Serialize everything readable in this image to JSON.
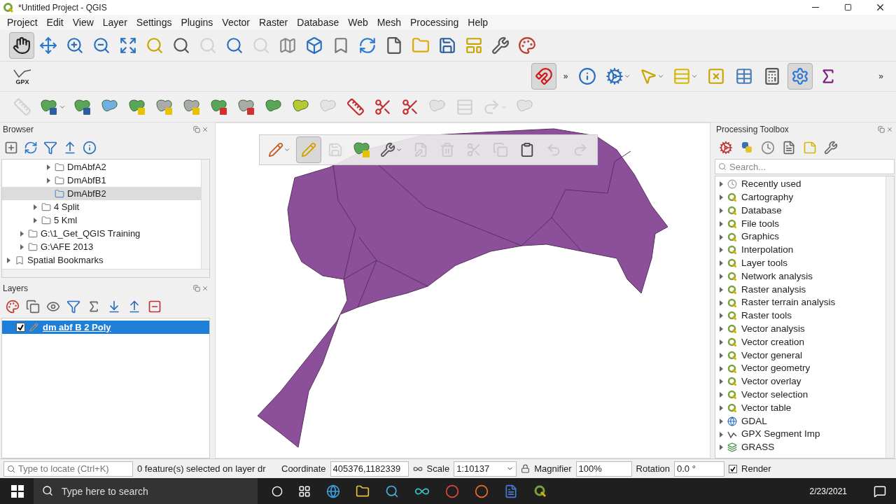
{
  "window": {
    "title": "*Untitled Project - QGIS"
  },
  "menu": [
    "Project",
    "Edit",
    "View",
    "Layer",
    "Settings",
    "Plugins",
    "Vector",
    "Raster",
    "Database",
    "Web",
    "Mesh",
    "Processing",
    "Help"
  ],
  "toolbar_1": [
    {
      "disabled": false,
      "selected": true
    },
    {
      "disabled": false,
      "selected": false
    },
    {
      "disabled": false,
      "selected": false
    },
    {
      "disabled": false,
      "selected": false
    },
    {
      "disabled": false,
      "selected": false
    },
    {
      "disabled": false,
      "selected": false
    },
    {
      "disabled": false,
      "selected": false
    },
    {
      "disabled": true,
      "selected": false
    },
    {
      "disabled": false,
      "selected": false
    },
    {
      "disabled": true,
      "selected": false
    },
    {
      "disabled": false,
      "selected": false
    },
    {
      "disabled": false,
      "selected": false
    },
    {
      "disabled": false,
      "selected": false
    },
    {
      "disabled": false,
      "selected": false
    },
    {
      "disabled": false,
      "selected": false
    },
    {
      "disabled": false,
      "selected": false
    },
    {
      "disabled": false,
      "selected": false
    },
    {
      "disabled": false,
      "selected": false
    },
    {
      "disabled": false,
      "selected": false
    },
    {
      "disabled": false,
      "selected": false
    }
  ],
  "gpx_label": "GPX",
  "toolbar_2": {
    "overflow": "»",
    "end_overflow": "»",
    "buttons": [
      {
        "selected": true
      },
      {
        "selected": false
      },
      {
        "selected": false
      },
      {
        "selected": false
      },
      {
        "selected": false
      },
      {
        "selected": false
      },
      {
        "selected": false
      },
      {
        "selected": false
      },
      {
        "selected": true
      },
      {
        "selected": false
      }
    ]
  },
  "toolbar_3": [
    {
      "disabled": true
    },
    {
      "disabled": false
    },
    {
      "disabled": false
    },
    {
      "disabled": false
    },
    {
      "disabled": false
    },
    {
      "disabled": false
    },
    {
      "disabled": false
    },
    {
      "disabled": false
    },
    {
      "disabled": false
    },
    {
      "disabled": false
    },
    {
      "disabled": false
    },
    {
      "disabled": true
    },
    {
      "disabled": false
    },
    {
      "disabled": false
    },
    {
      "disabled": false
    },
    {
      "disabled": true
    },
    {
      "disabled": true
    },
    {
      "disabled": true
    },
    {
      "disabled": true
    }
  ],
  "digitizing_toolbar": [
    {
      "disabled": false,
      "selected": false
    },
    {
      "disabled": false,
      "selected": true
    },
    {
      "disabled": true,
      "selected": false
    },
    {
      "disabled": false,
      "selected": false
    },
    {
      "disabled": false,
      "selected": false
    },
    {
      "disabled": true,
      "selected": false
    },
    {
      "disabled": true,
      "selected": false
    },
    {
      "disabled": true,
      "selected": false
    },
    {
      "disabled": true,
      "selected": false
    },
    {
      "disabled": false,
      "selected": false
    },
    {
      "disabled": true,
      "selected": false
    },
    {
      "disabled": true,
      "selected": false
    }
  ],
  "browser": {
    "title": "Browser",
    "items": [
      {
        "children": [
          {
            "children": [
              {
                "children": [
                  {
                    "label": "DmAbfA2",
                    "expandable": true,
                    "expanded": false,
                    "selected": false,
                    "kind": "folder"
                  },
                  {
                    "label": "DmAbfB1",
                    "expandable": true,
                    "expanded": false,
                    "selected": false,
                    "kind": "folder"
                  },
                  {
                    "label": "DmAbfB2",
                    "expandable": false,
                    "expanded": false,
                    "selected": true,
                    "kind": "folder"
                  }
                ]
              },
              {
                "label": "4 Split",
                "expandable": true,
                "expanded": false,
                "selected": false,
                "kind": "folder"
              },
              {
                "label": "5 Kml",
                "expandable": true,
                "expanded": false,
                "selected": false,
                "kind": "folder"
              }
            ]
          },
          {
            "label": "G:\\1_Get_QGIS Training",
            "expandable": true,
            "expanded": false,
            "selected": false,
            "kind": "folder"
          },
          {
            "label": "G:\\AFE 2013",
            "expandable": true,
            "expanded": false,
            "selected": false,
            "kind": "folder"
          }
        ]
      },
      {
        "label": "Spatial Bookmarks",
        "expandable": true,
        "expanded": false,
        "selected": false,
        "kind": "bookmarks"
      }
    ]
  },
  "layers": {
    "title": "Layers",
    "items": [
      {
        "label": "dm abf B 2 Poly",
        "checked": true,
        "selected": true
      }
    ]
  },
  "toolbox": {
    "title": "Processing Toolbox",
    "search_placeholder": "Search...",
    "items": [
      {
        "label": "Recently used",
        "kind": "recent"
      },
      {
        "label": "Cartography",
        "kind": "qgis"
      },
      {
        "label": "Database",
        "kind": "qgis"
      },
      {
        "label": "File tools",
        "kind": "qgis"
      },
      {
        "label": "Graphics",
        "kind": "qgis"
      },
      {
        "label": "Interpolation",
        "kind": "qgis"
      },
      {
        "label": "Layer tools",
        "kind": "qgis"
      },
      {
        "label": "Network analysis",
        "kind": "qgis"
      },
      {
        "label": "Raster analysis",
        "kind": "qgis"
      },
      {
        "label": "Raster terrain analysis",
        "kind": "qgis"
      },
      {
        "label": "Raster tools",
        "kind": "qgis"
      },
      {
        "label": "Vector analysis",
        "kind": "qgis"
      },
      {
        "label": "Vector creation",
        "kind": "qgis"
      },
      {
        "label": "Vector general",
        "kind": "qgis"
      },
      {
        "label": "Vector geometry",
        "kind": "qgis"
      },
      {
        "label": "Vector overlay",
        "kind": "qgis"
      },
      {
        "label": "Vector selection",
        "kind": "qgis"
      },
      {
        "label": "Vector table",
        "kind": "qgis"
      },
      {
        "label": "GDAL",
        "kind": "gdal"
      },
      {
        "label": "GPX Segment Imp",
        "kind": "gpx"
      },
      {
        "label": "GRASS",
        "kind": "grass"
      }
    ]
  },
  "status_bar": {
    "locate_placeholder": "Type to locate (Ctrl+K)",
    "message": "0 feature(s) selected on layer dr",
    "coordinate_label": "Coordinate",
    "coordinate": "405376,1182339",
    "scale_label": "Scale",
    "scale": "1:10137",
    "magnifier_label": "Magnifier",
    "magnifier": "100%",
    "rotation_label": "Rotation",
    "rotation": "0.0 °",
    "render_label": "Render",
    "render_checked": true
  },
  "taskbar": {
    "search_placeholder": "Type here to search",
    "date": "2/23/2021"
  }
}
